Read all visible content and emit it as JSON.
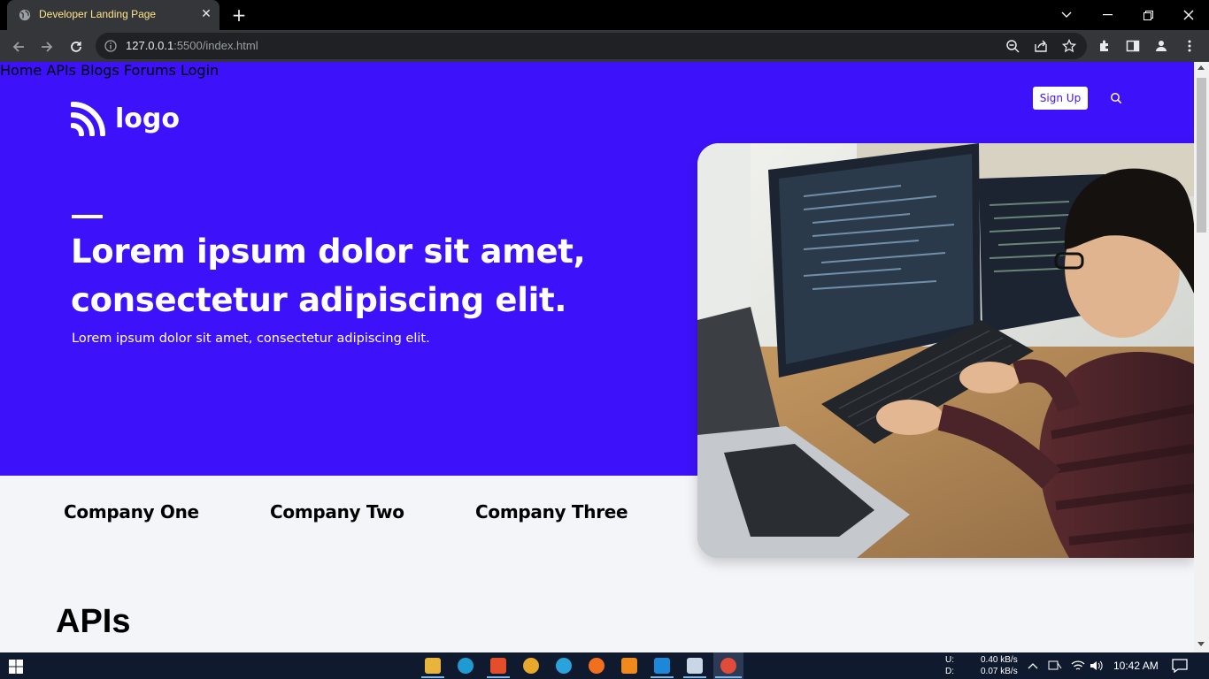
{
  "browser": {
    "tab_title": "Developer Landing Page",
    "url_host": "127.0.0.1",
    "url_rest": ":5500/index.html"
  },
  "site": {
    "logo_text": "logo",
    "nav": [
      "Home",
      "APIs",
      "Blogs",
      "Forums",
      "Login"
    ],
    "signup_label": "Sign Up",
    "headline_line1": "Lorem ipsum dolor sit amet,",
    "headline_line2": "consectetur adipiscing elit.",
    "subtext": "Lorem ipsum dolor sit amet, consectetur adipiscing elit.",
    "companies": [
      "Company One",
      "Company Two",
      "Company Three"
    ],
    "section_title": "APIs"
  },
  "colors": {
    "brand": "#3d12fa",
    "page_bg": "#f4f5f9"
  },
  "taskbar": {
    "net_up_label": "U:",
    "net_down_label": "D:",
    "net_up": "0.40 kB/s",
    "net_down": "0.07 kB/s",
    "time": "10:42 AM"
  }
}
